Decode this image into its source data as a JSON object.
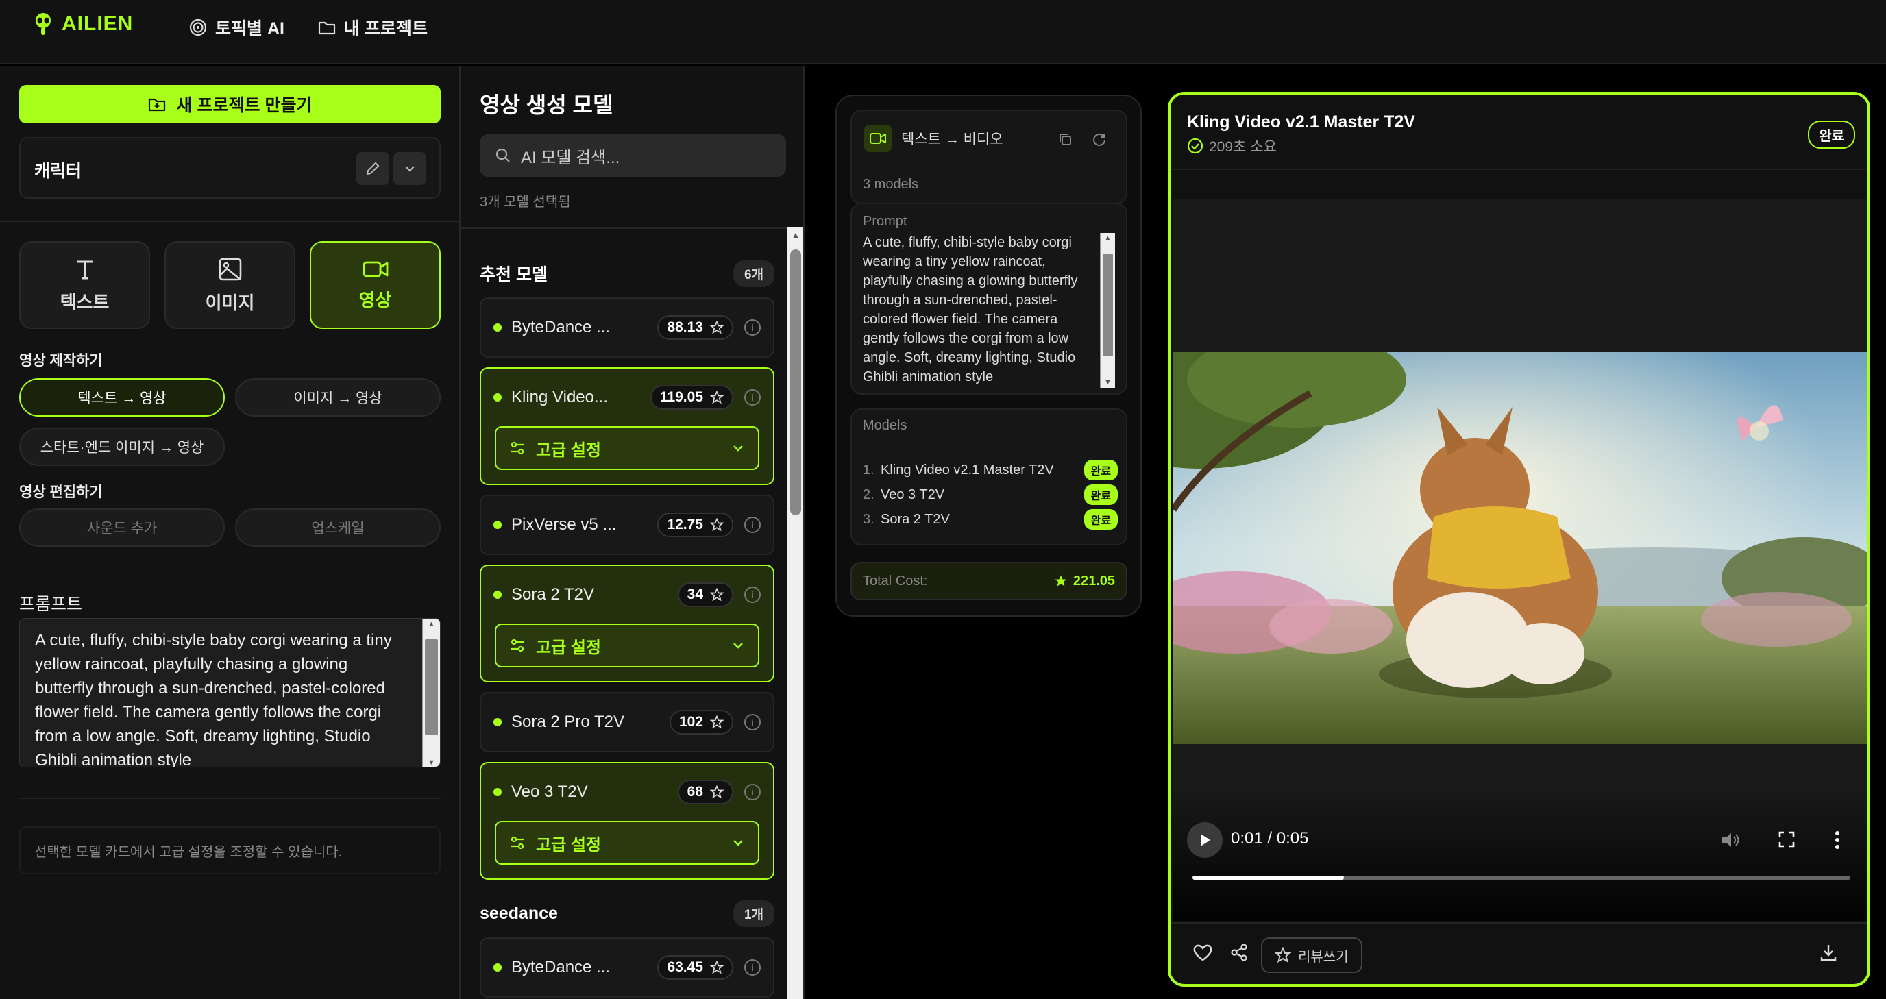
{
  "topbar": {
    "logo": "AILIEN",
    "nav": [
      "토픽별 AI",
      "내 프로젝트"
    ]
  },
  "left": {
    "new_project": "새 프로젝트 만들기",
    "project_name": "캐릭터",
    "modes": [
      "텍스트",
      "이미지",
      "영상"
    ],
    "active_mode": "영상",
    "create_section": "영상 제작하기",
    "create_options": [
      "텍스트 → 영상",
      "이미지 → 영상",
      "스타트·엔드 이미지 → 영상"
    ],
    "edit_section": "영상 편집하기",
    "edit_options": [
      "사운드 추가",
      "업스케일"
    ],
    "prompt_label": "프롬프트",
    "prompt_text": "A cute, fluffy, chibi-style baby corgi wearing a tiny yellow raincoat, playfully chasing a glowing butterfly through a sun-drenched, pastel-colored flower field. The camera gently follows the corgi from a low angle. Soft, dreamy lighting, Studio Ghibli animation style",
    "hint": "선택한 모델 카드에서 고급 설정을 조정할 수 있습니다."
  },
  "models_panel": {
    "title": "영상 생성 모델",
    "search_placeholder": "AI 모델 검색...",
    "selected_count": "3개 모델 선택됨",
    "advanced_label": "고급 설정",
    "groups": [
      {
        "name": "추천 모델",
        "count": "6개",
        "items": [
          {
            "name": "ByteDance ...",
            "price": "88.13",
            "selected": false
          },
          {
            "name": "Kling Video...",
            "price": "119.05",
            "selected": true
          },
          {
            "name": "PixVerse v5 ...",
            "price": "12.75",
            "selected": false
          },
          {
            "name": "Sora 2 T2V",
            "price": "34",
            "selected": true
          },
          {
            "name": "Sora 2 Pro T2V",
            "price": "102",
            "selected": false
          },
          {
            "name": "Veo 3 T2V",
            "price": "68",
            "selected": true
          }
        ]
      },
      {
        "name": "seedance",
        "count": "1개",
        "items": [
          {
            "name": "ByteDance ...",
            "price": "63.45",
            "selected": false
          }
        ]
      }
    ]
  },
  "summary": {
    "task": "텍스트 → 비디오",
    "models_count": "3 models",
    "prompt_label": "Prompt",
    "prompt_text": "A cute, fluffy, chibi-style baby corgi wearing a tiny yellow raincoat, playfully chasing a glowing butterfly through a sun-drenched, pastel-colored flower field. The camera gently follows the corgi from a low angle. Soft, dreamy lighting, Studio Ghibli animation style",
    "models_label": "Models",
    "models": [
      {
        "n": "1.",
        "name": "Kling Video v2.1 Master T2V",
        "status": "완료"
      },
      {
        "n": "2.",
        "name": "Veo 3 T2V",
        "status": "완료"
      },
      {
        "n": "3.",
        "name": "Sora 2 T2V",
        "status": "완료"
      }
    ],
    "total_label": "Total Cost:",
    "total_value": "221.05"
  },
  "result": {
    "title": "Kling Video v2.1 Master T2V",
    "time": "209초 소요",
    "status": "완료",
    "player_time": "0:01 / 0:05",
    "progress": 0.23,
    "review": "리뷰쓰기"
  },
  "colors": {
    "accent": "#a8ff1a",
    "bg": "#121212"
  }
}
